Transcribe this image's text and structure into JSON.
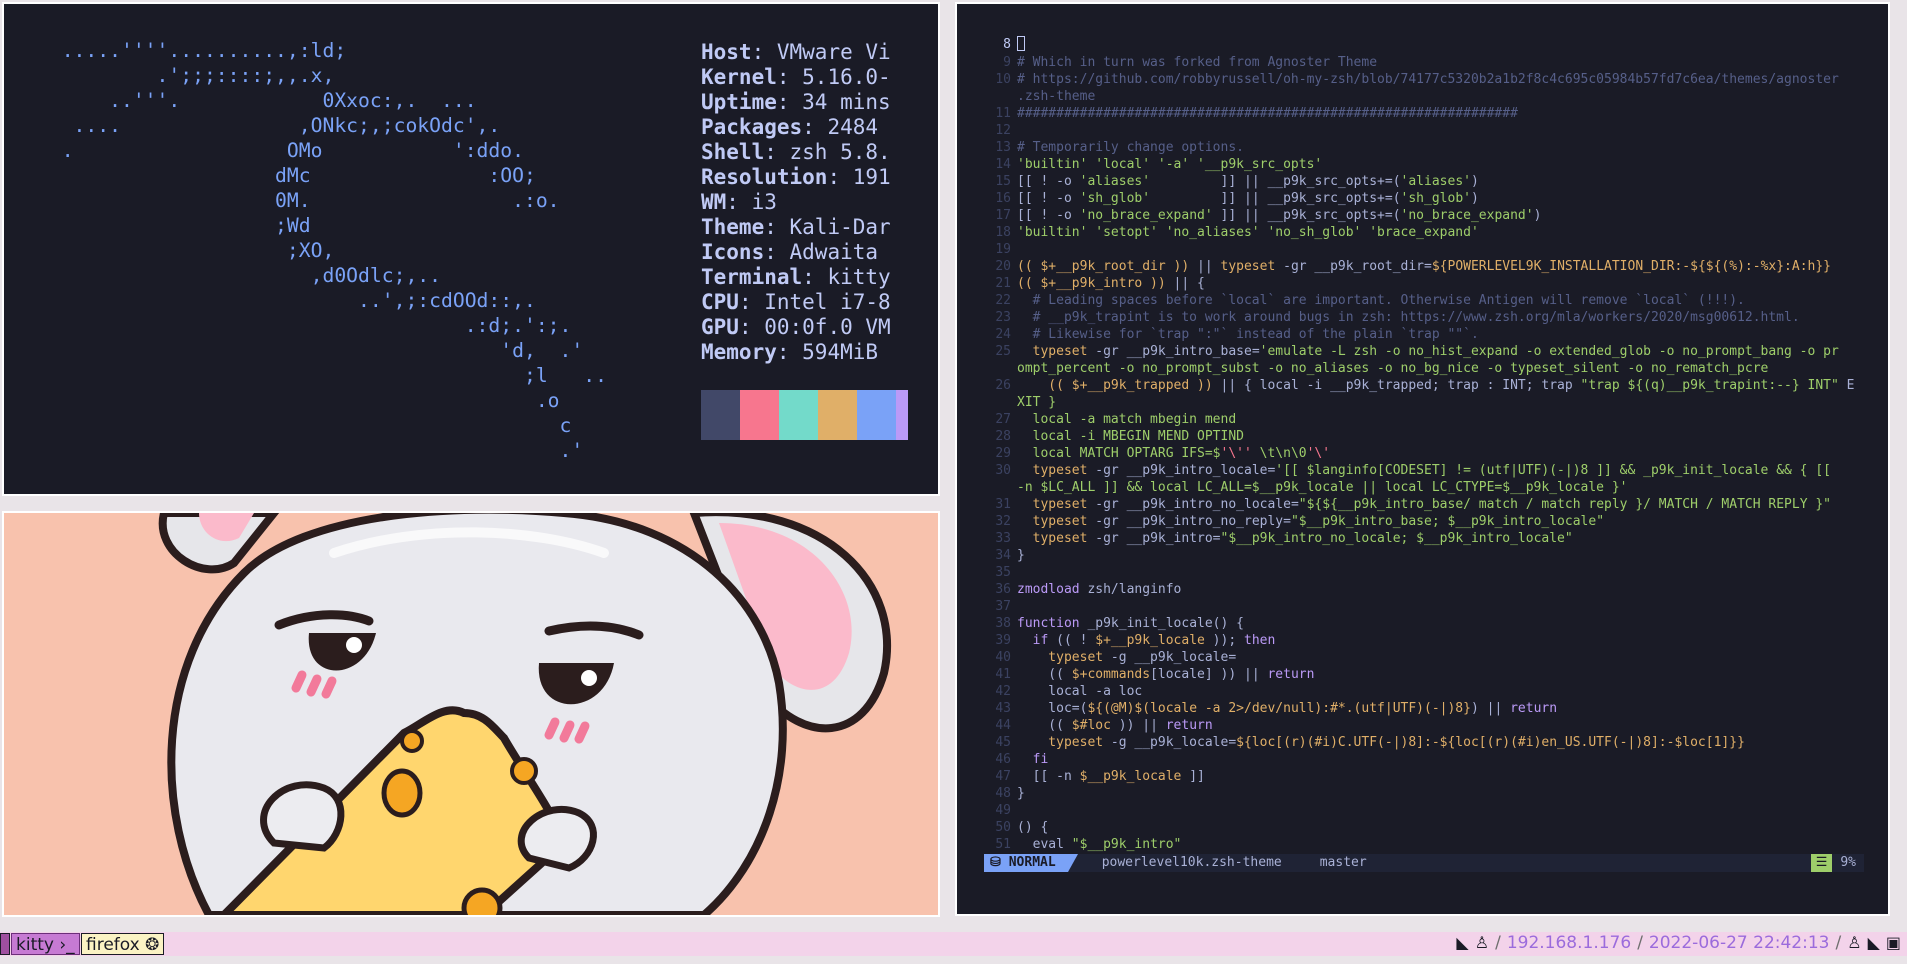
{
  "fetch": {
    "ascii": [
      "  .....''''..........,:ld;",
      "          .';;;::::;,,.x,",
      "      ..'''.            0Xxoc:,.  ...",
      "   ....               ,ONkc;,;cokOdc',.",
      "  .                  OMo           ':ddo.",
      "                    dMc               :OO;",
      "                    0M.                 .:o.",
      "                    ;Wd",
      "                     ;XO,",
      "                       ,d0Odlc;,..",
      "                           ..',;:cdOOd::,.",
      "                                    .:d;.':;.",
      "                                       'd,  .'",
      "                                         ;l   ..",
      "                                          .o",
      "                                            c",
      "                                            .'"
    ],
    "info": [
      {
        "key": "Host",
        "value": "VMware Vi"
      },
      {
        "key": "Kernel",
        "value": "5.16.0-"
      },
      {
        "key": "Uptime",
        "value": "34 mins"
      },
      {
        "key": "Packages",
        "value": "2484"
      },
      {
        "key": "Shell",
        "value": "zsh 5.8."
      },
      {
        "key": "Resolution",
        "value": "191"
      },
      {
        "key": "WM",
        "value": "i3"
      },
      {
        "key": "Theme",
        "value": "Kali-Dar"
      },
      {
        "key": "Icons",
        "value": "Adwaita"
      },
      {
        "key": "Terminal",
        "value": "kitty"
      },
      {
        "key": "CPU",
        "value": "Intel i7-8"
      },
      {
        "key": "GPU",
        "value": "00:0f.0 VM"
      },
      {
        "key": "Memory",
        "value": "594MiB"
      }
    ],
    "palette": [
      "#414868",
      "#f7768e",
      "#73daca",
      "#e0af68",
      "#7aa2f7",
      "#bb9af7"
    ]
  },
  "vim": {
    "mode": "NORMAL",
    "filename": "powerlevel10k.zsh-theme",
    "branch_icon": "",
    "branch": "master",
    "percent_icon": "☰",
    "percent": "9%",
    "lines": [
      {
        "n": "8",
        "cur": true,
        "parts": []
      },
      {
        "n": "9",
        "parts": [
          [
            "cm",
            "# Which in turn was forked from Agnoster Theme"
          ]
        ]
      },
      {
        "n": "10",
        "parts": [
          [
            "cm",
            "# https://github.com/robbyrussell/oh-my-zsh/blob/74177c5320b2a1b2f8c4c695c05984b57fd7c6ea/themes/agnoster"
          ]
        ]
      },
      {
        "n": "",
        "parts": [
          [
            "cm",
            ".zsh-theme"
          ]
        ]
      },
      {
        "n": "11",
        "parts": [
          [
            "cm",
            "################################################################"
          ]
        ]
      },
      {
        "n": "12",
        "parts": []
      },
      {
        "n": "13",
        "parts": [
          [
            "cm",
            "# Temporarily change options."
          ]
        ]
      },
      {
        "n": "14",
        "parts": [
          [
            "st",
            "'builtin' 'local' '-a' '__p9k_src_opts'"
          ]
        ]
      },
      {
        "n": "15",
        "parts": [
          [
            "",
            "[[ ! -o "
          ],
          [
            "st",
            "'aliases'"
          ],
          [
            "",
            "         ]] || __p9k_src_opts+=("
          ],
          [
            "st",
            "'aliases'"
          ],
          [
            "",
            ")"
          ]
        ]
      },
      {
        "n": "16",
        "parts": [
          [
            "",
            "[[ ! -o "
          ],
          [
            "st",
            "'sh_glob'"
          ],
          [
            "",
            "         ]] || __p9k_src_opts+=("
          ],
          [
            "st",
            "'sh_glob'"
          ],
          [
            "",
            ")"
          ]
        ]
      },
      {
        "n": "17",
        "parts": [
          [
            "",
            "[[ ! -o "
          ],
          [
            "st",
            "'no_brace_expand'"
          ],
          [
            "",
            " ]] || __p9k_src_opts+=("
          ],
          [
            "st",
            "'no_brace_expand'"
          ],
          [
            "",
            ")"
          ]
        ]
      },
      {
        "n": "18",
        "parts": [
          [
            "st",
            "'builtin' 'setopt' 'no_aliases' 'no_sh_glob' 'brace_expand'"
          ]
        ]
      },
      {
        "n": "19",
        "parts": []
      },
      {
        "n": "20",
        "parts": [
          [
            "va",
            "(( $+__p9k_root_dir ))"
          ],
          [
            "",
            " || "
          ],
          [
            "va",
            "typeset"
          ],
          [
            "",
            " -gr __p9k_root_dir="
          ],
          [
            "va",
            "${POWERLEVEL9K_INSTALLATION_DIR:-${${(%):-%x}:A:h}}"
          ]
        ]
      },
      {
        "n": "21",
        "parts": [
          [
            "va",
            "(( $+__p9k_intro ))"
          ],
          [
            "",
            " || {"
          ]
        ]
      },
      {
        "n": "22",
        "parts": [
          [
            "cm",
            "  # Leading spaces before `local` are important. Otherwise Antigen will remove `local` (!!!)."
          ]
        ]
      },
      {
        "n": "23",
        "parts": [
          [
            "cm",
            "  # __p9k_trapint is to work around bugs in zsh: https://www.zsh.org/mla/workers/2020/msg00612.html."
          ]
        ]
      },
      {
        "n": "24",
        "parts": [
          [
            "cm",
            "  # Likewise for `trap \":\"` instead of the plain `trap \"\"`."
          ]
        ]
      },
      {
        "n": "25",
        "parts": [
          [
            "va",
            "  typeset"
          ],
          [
            "",
            " -gr __p9k_intro_base="
          ],
          [
            "st",
            "'emulate -L zsh -o no_hist_expand -o extended_glob -o no_prompt_bang -o pr"
          ]
        ]
      },
      {
        "n": "",
        "parts": [
          [
            "st",
            "ompt_percent -o no_prompt_subst -o no_aliases -o no_bg_nice -o typeset_silent -o no_rematch_pcre"
          ]
        ]
      },
      {
        "n": "26",
        "parts": [
          [
            "va",
            "    (( $+__p9k_trapped ))"
          ],
          [
            "",
            " || { local -i __p9k_trapped; trap : INT; trap "
          ],
          [
            "st",
            "\"trap ${(q)__p9k_trapint:--} INT\""
          ],
          [
            "",
            " E"
          ]
        ]
      },
      {
        "n": "",
        "parts": [
          [
            "st",
            "XIT }"
          ]
        ]
      },
      {
        "n": "27",
        "parts": [
          [
            "st",
            "  local -a match mbegin mend"
          ]
        ]
      },
      {
        "n": "28",
        "parts": [
          [
            "st",
            "  local -i MBEGIN MEND OPTIND"
          ]
        ]
      },
      {
        "n": "29",
        "parts": [
          [
            "st",
            "  local MATCH OPTARG IFS=$"
          ],
          [
            "rd",
            "'\\''"
          ],
          [
            "st",
            " \\t\\n\\0"
          ],
          [
            "rd",
            "'\\'"
          ]
        ]
      },
      {
        "n": "30",
        "parts": [
          [
            "va",
            "  typeset"
          ],
          [
            "",
            " -gr __p9k_intro_locale="
          ],
          [
            "st",
            "'[[ $langinfo[CODESET] != (utf|UTF)(-|)8 ]] && _p9k_init_locale && { [["
          ]
        ]
      },
      {
        "n": "",
        "parts": [
          [
            "st",
            "-n $LC_ALL ]] && local LC_ALL=$__p9k_locale || local LC_CTYPE=$__p9k_locale }'"
          ]
        ]
      },
      {
        "n": "31",
        "parts": [
          [
            "va",
            "  typeset"
          ],
          [
            "",
            " -gr __p9k_intro_no_locale="
          ],
          [
            "st",
            "\"${${__p9k_intro_base/ match / match reply }/ MATCH / MATCH REPLY }\""
          ]
        ]
      },
      {
        "n": "32",
        "parts": [
          [
            "va",
            "  typeset"
          ],
          [
            "",
            " -gr __p9k_intro_no_reply="
          ],
          [
            "st",
            "\"$__p9k_intro_base; $__p9k_intro_locale\""
          ]
        ]
      },
      {
        "n": "33",
        "parts": [
          [
            "va",
            "  typeset"
          ],
          [
            "",
            " -gr __p9k_intro="
          ],
          [
            "st",
            "\"$__p9k_intro_no_locale; $__p9k_intro_locale\""
          ]
        ]
      },
      {
        "n": "34",
        "parts": [
          [
            "",
            "}"
          ]
        ]
      },
      {
        "n": "35",
        "parts": []
      },
      {
        "n": "36",
        "parts": [
          [
            "kw",
            "zmodload"
          ],
          [
            "",
            " zsh/langinfo"
          ]
        ]
      },
      {
        "n": "37",
        "parts": []
      },
      {
        "n": "38",
        "parts": [
          [
            "kw",
            "function"
          ],
          [
            "",
            " _p9k_init_locale() {"
          ]
        ]
      },
      {
        "n": "39",
        "parts": [
          [
            "kw",
            "  if"
          ],
          [
            "",
            " (( ! "
          ],
          [
            "va",
            "$+__p9k_locale"
          ],
          [
            "",
            " )); "
          ],
          [
            "kw",
            "then"
          ]
        ]
      },
      {
        "n": "40",
        "parts": [
          [
            "va",
            "    typeset"
          ],
          [
            "",
            " -g __p9k_locale="
          ]
        ]
      },
      {
        "n": "41",
        "parts": [
          [
            "",
            "    (( "
          ],
          [
            "va",
            "$+commands"
          ],
          [
            "",
            "[locale] )) || "
          ],
          [
            "kw",
            "return"
          ]
        ]
      },
      {
        "n": "42",
        "parts": [
          [
            "",
            "    local -a loc"
          ]
        ]
      },
      {
        "n": "43",
        "parts": [
          [
            "",
            "    loc=("
          ],
          [
            "va",
            "${(@M)$(locale -a 2>/dev/null):#*.(utf|UTF)(-|)8}"
          ],
          [
            "",
            ") || "
          ],
          [
            "kw",
            "return"
          ]
        ]
      },
      {
        "n": "44",
        "parts": [
          [
            "",
            "    (( "
          ],
          [
            "va",
            "$#loc"
          ],
          [
            "",
            " )) || "
          ],
          [
            "kw",
            "return"
          ]
        ]
      },
      {
        "n": "45",
        "parts": [
          [
            "va",
            "    typeset"
          ],
          [
            "",
            " -g __p9k_locale="
          ],
          [
            "va",
            "${loc[(r)(#i)C.UTF(-|)8]:-${loc[(r)(#i)en_US.UTF(-|)8]:-$loc[1]}}"
          ]
        ]
      },
      {
        "n": "46",
        "parts": [
          [
            "kw",
            "  fi"
          ]
        ]
      },
      {
        "n": "47",
        "parts": [
          [
            "",
            "  [[ -n "
          ],
          [
            "va",
            "$__p9k_locale"
          ],
          [
            "",
            " ]]"
          ]
        ]
      },
      {
        "n": "48",
        "parts": [
          [
            "",
            "}"
          ]
        ]
      },
      {
        "n": "49",
        "parts": []
      },
      {
        "n": "50",
        "parts": [
          [
            "",
            "() {"
          ]
        ]
      },
      {
        "n": "51",
        "parts": [
          [
            "",
            "  eval "
          ],
          [
            "st",
            "\"$__p9k_intro\""
          ]
        ]
      }
    ]
  },
  "bar": {
    "workspaces": [
      "",
      "kitty ›_",
      "firefox ❂"
    ],
    "ip": "192.168.1.176",
    "datetime": "2022-06-27 22:42:13",
    "separator": "/"
  }
}
